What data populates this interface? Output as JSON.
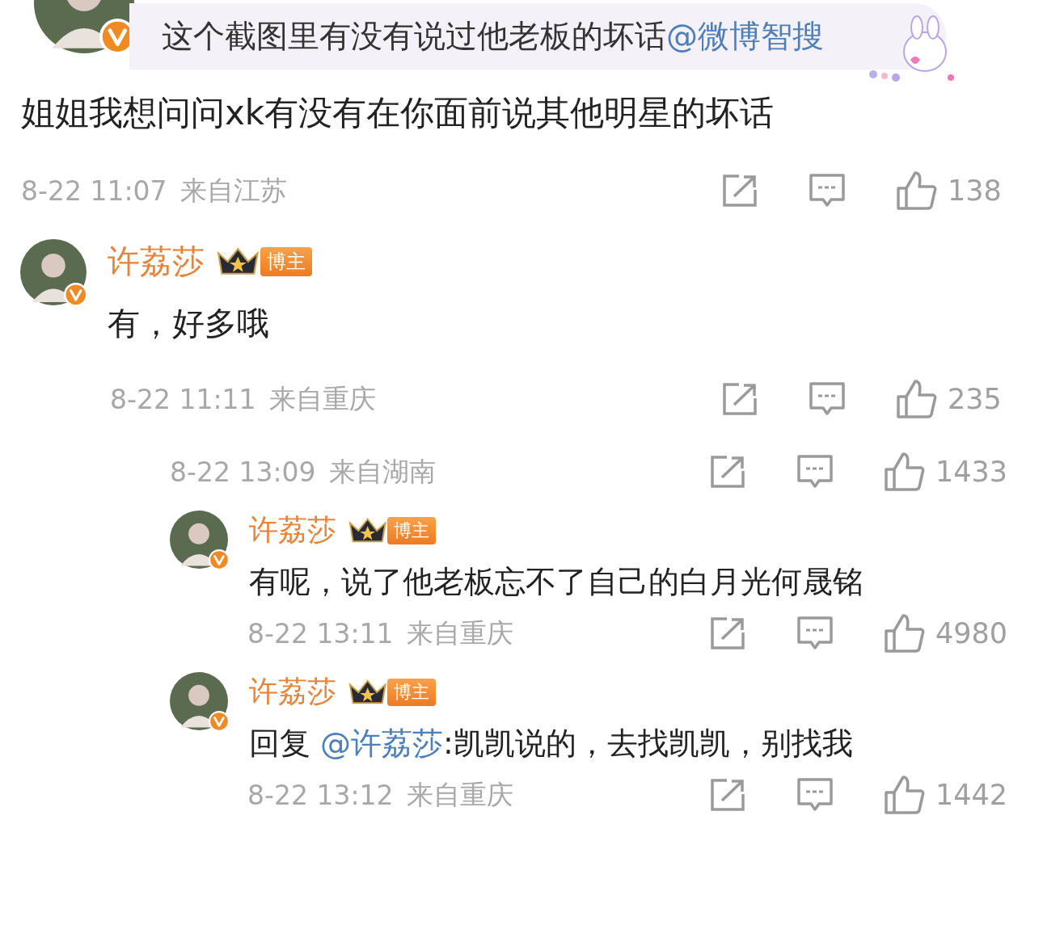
{
  "quote": {
    "text": "这个截图里有没有说过他老板的坏话",
    "mention": "@微博智搜",
    "verified": true
  },
  "comment": {
    "text": "姐姐我想问问xk有没有在你面前说其他明星的坏话",
    "time": "8-22 11:07",
    "location": "来自江苏",
    "likes": "138"
  },
  "replies": [
    {
      "kind": "full",
      "author": "许荔莎",
      "badge": "博主",
      "verified": true,
      "text": "有，好多哦",
      "time": "8-22 11:11",
      "location": "来自重庆",
      "likes": "235"
    }
  ],
  "sub_replies": [
    {
      "kind": "meta",
      "time": "8-22 13:09",
      "location": "来自湖南",
      "likes": "1433"
    },
    {
      "kind": "full",
      "author": "许荔莎",
      "badge": "博主",
      "verified": true,
      "text": "有呢，说了他老板忘不了自己的白月光何晟铭",
      "time": "8-22 13:11",
      "location": "来自重庆",
      "likes": "4980"
    },
    {
      "kind": "reply",
      "author": "许荔莎",
      "badge": "博主",
      "verified": true,
      "prefix": "回复",
      "mention": "@许荔莎",
      "text": ":凯凯说的，去找凯凯，别找我",
      "time": "8-22 13:12",
      "location": "来自重庆",
      "likes": "1442"
    }
  ]
}
